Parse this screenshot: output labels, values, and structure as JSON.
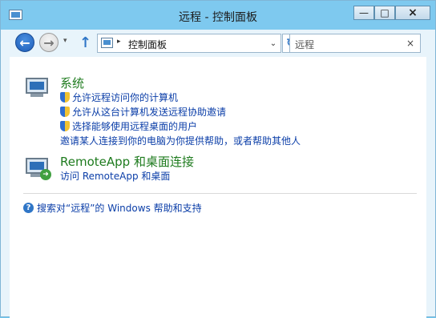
{
  "window": {
    "title": "远程 - 控制面板"
  },
  "window_controls": {
    "minimize": "—",
    "maximize": "□",
    "close": "×"
  },
  "toolbar": {
    "back_icon": "←",
    "forward_icon": "→",
    "recent_icon": "▾",
    "up_icon": "↑",
    "address": {
      "separator": "▸",
      "text": "控制面板",
      "dropdown": "⌄"
    },
    "refresh_icon": "↻",
    "search": {
      "value": "远程",
      "clear": "×"
    }
  },
  "groups": [
    {
      "heading": "系统",
      "items": [
        {
          "label": "允许远程访问你的计算机",
          "shield": true
        },
        {
          "label": "允许从这台计算机发送远程协助邀请",
          "shield": true
        },
        {
          "label": "选择能够使用远程桌面的用户",
          "shield": true
        },
        {
          "label": "邀请某人连接到你的电脑为你提供帮助，或者帮助其他人",
          "shield": false
        }
      ]
    },
    {
      "heading": "RemoteApp 和桌面连接",
      "items": [
        {
          "label": "访问 RemoteApp 和桌面",
          "shield": false
        }
      ]
    }
  ],
  "help": {
    "icon": "?",
    "text": "搜索对“远程”的 Windows 帮助和支持"
  }
}
